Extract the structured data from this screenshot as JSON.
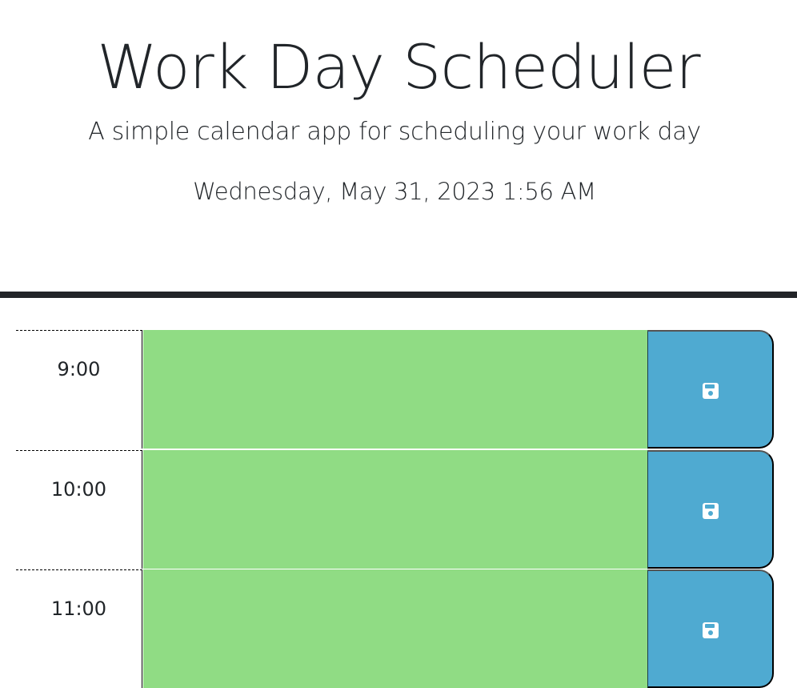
{
  "header": {
    "title": "Work Day Scheduler",
    "subtitle": "A simple calendar app for scheduling your work day",
    "current_date": "Wednesday, May 31, 2023 1:56 AM"
  },
  "colors": {
    "future": "#90dc84",
    "save_button": "#4faad1",
    "divider": "#222428"
  },
  "timeblocks": [
    {
      "hour": "9:00",
      "status": "future",
      "text": "",
      "save_icon": "floppy-disk-icon"
    },
    {
      "hour": "10:00",
      "status": "future",
      "text": "",
      "save_icon": "floppy-disk-icon"
    },
    {
      "hour": "11:00",
      "status": "future",
      "text": "",
      "save_icon": "floppy-disk-icon"
    }
  ]
}
